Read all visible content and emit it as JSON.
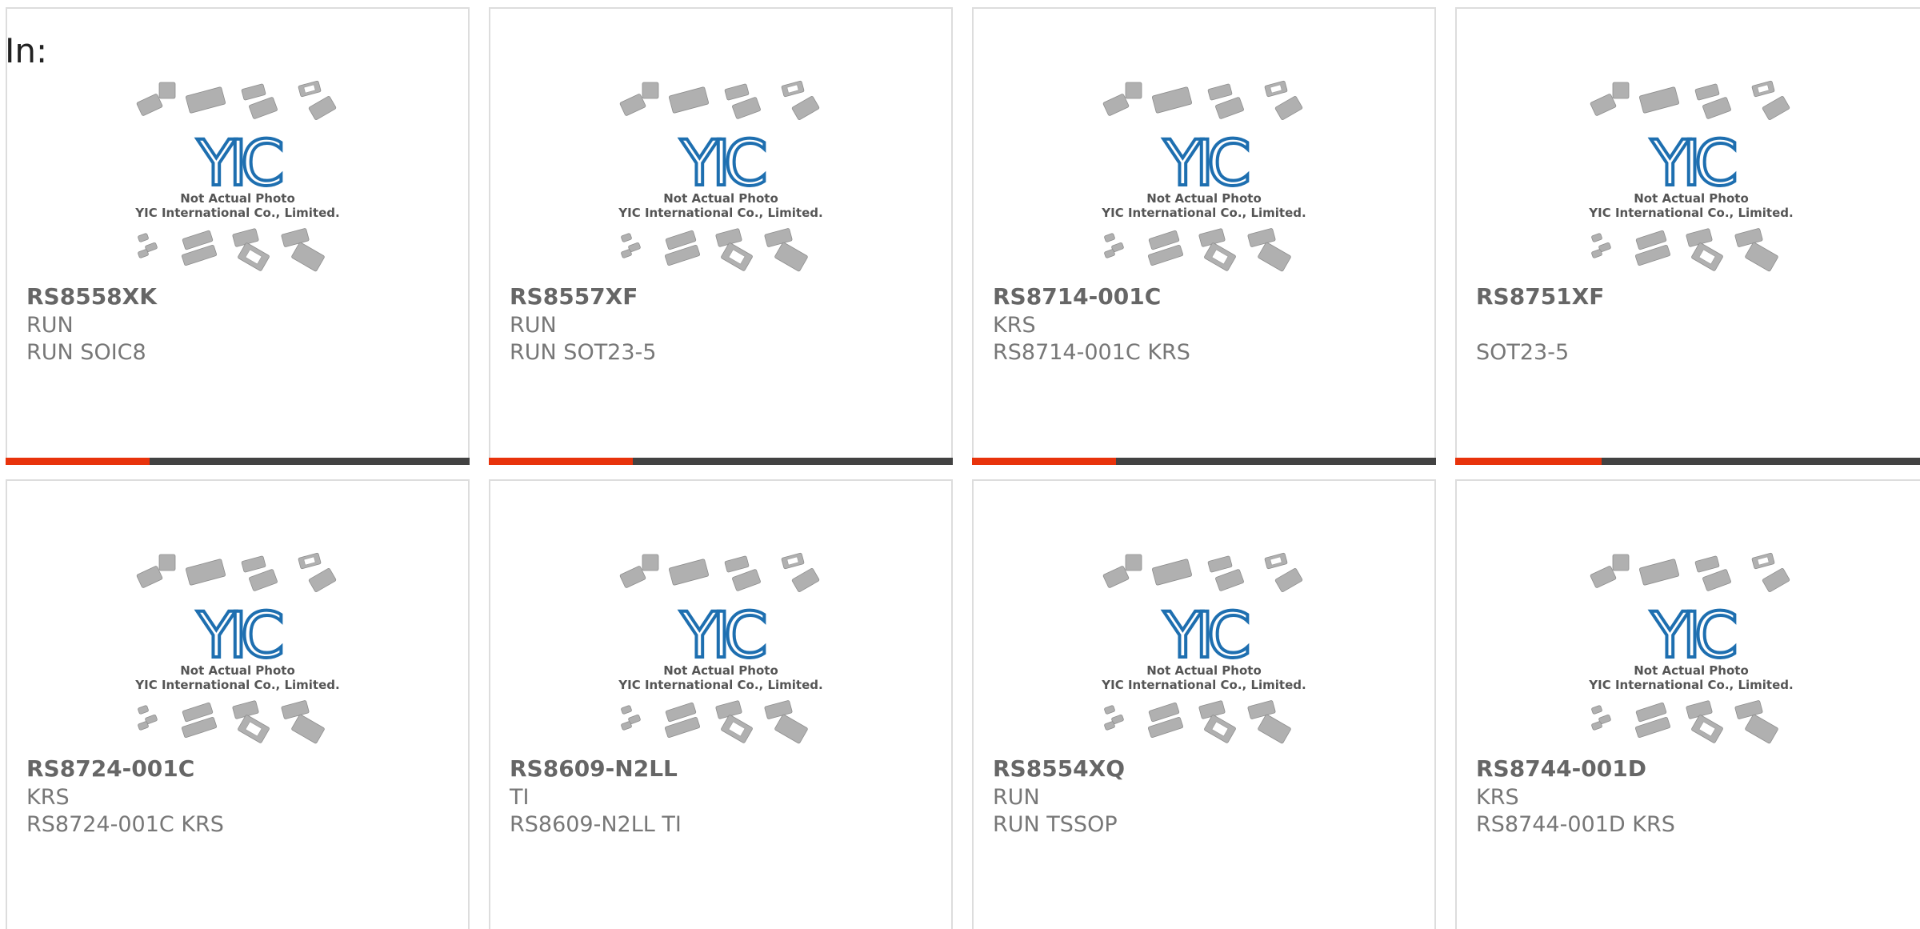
{
  "heading": "In:",
  "placeholder": {
    "line1": "Not Actual Photo",
    "line2": "YIC International Co., Limited.",
    "logo_text": "YIC",
    "logo_color": "#1e6fb0",
    "package_color": "#b0b0b0"
  },
  "accent_color": "#e8330c",
  "track_color": "#424242",
  "products": [
    {
      "part_no": "RS8558XK",
      "brand": "RUN",
      "desc": "RUN SOIC8",
      "progress": 0.31
    },
    {
      "part_no": "RS8557XF",
      "brand": "RUN",
      "desc": "RUN SOT23-5",
      "progress": 0.31
    },
    {
      "part_no": "RS8714-001C",
      "brand": "KRS",
      "desc": "RS8714-001C KRS",
      "progress": 0.31
    },
    {
      "part_no": "RS8751XF",
      "brand": "",
      "desc": "SOT23-5",
      "progress": 0.31
    },
    {
      "part_no": "RS8724-001C",
      "brand": "KRS",
      "desc": "RS8724-001C KRS",
      "progress": 0
    },
    {
      "part_no": "RS8609-N2LL",
      "brand": "TI",
      "desc": "RS8609-N2LL TI",
      "progress": 0
    },
    {
      "part_no": "RS8554XQ",
      "brand": "RUN",
      "desc": "RUN TSSOP",
      "progress": 0
    },
    {
      "part_no": "RS8744-001D",
      "brand": "KRS",
      "desc": "RS8744-001D KRS",
      "progress": 0
    }
  ]
}
